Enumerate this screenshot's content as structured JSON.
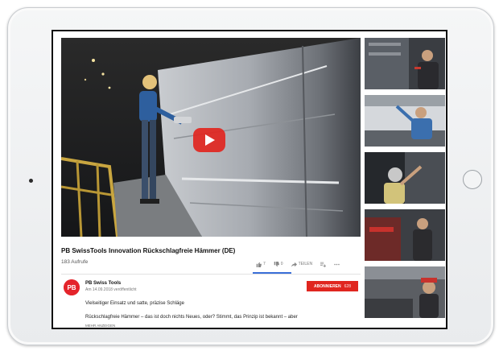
{
  "video": {
    "title": "PB SwissTools Innovation Rückschlagfreie Hämmer (DE)",
    "views": "183 Aufrufe"
  },
  "actions": {
    "likes": "7",
    "dislikes": "0",
    "share": "TEILEN",
    "add_icon": "playlist-add-icon",
    "more_icon": "more-horizontal-icon"
  },
  "channel": {
    "name": "PB Swiss Tools",
    "published": "Am 14.09.2018 veröffentlicht",
    "logo_text": "PB"
  },
  "subscribe": {
    "label": "ABONNIEREN",
    "count": "628"
  },
  "description": {
    "line1": "Vielseitiger Einsatz und satte, präzise Schläge",
    "line2": "Rückschlagfreie Hämmer – das ist doch nichts Neues, oder? Stimmt, das Prinzip ist bekannt – aber",
    "more": "MEHR ANZEIGEN"
  },
  "colors": {
    "brand_red": "#e0261f",
    "accent_blue": "#3a6fd8"
  }
}
